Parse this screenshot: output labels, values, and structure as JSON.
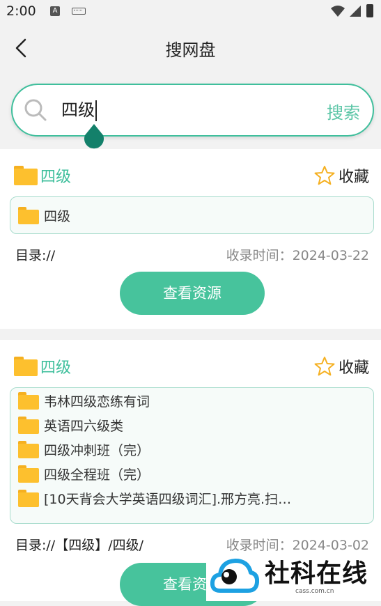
{
  "status_bar": {
    "time": "2:00",
    "a_badge": "A"
  },
  "header": {
    "title": "搜网盘"
  },
  "search": {
    "query": "四级",
    "button": "搜索"
  },
  "results": [
    {
      "title": "四级",
      "favorite_label": "收藏",
      "files": [
        "四级"
      ],
      "directory": "目录://",
      "date": "收录时间：2024-03-22",
      "view_button": "查看资源"
    },
    {
      "title": "四级",
      "favorite_label": "收藏",
      "files": [
        "韦林四级恋练有词",
        "英语四六级类",
        "四级冲刺班（完）",
        "四级全程班（完）",
        "[10天背会大学英语四级词汇].邢方亮.扫…"
      ],
      "directory": "目录://【四级】/四级/",
      "date": "收录时间：2024-03-02",
      "view_button": "查看资源"
    }
  ],
  "watermark": {
    "text": "社科在线",
    "url": "cass.com.cn"
  },
  "colors": {
    "accent": "#3fbf9c",
    "button": "#47c39c",
    "folder": "#fdc02e",
    "star": "#f5b021"
  }
}
